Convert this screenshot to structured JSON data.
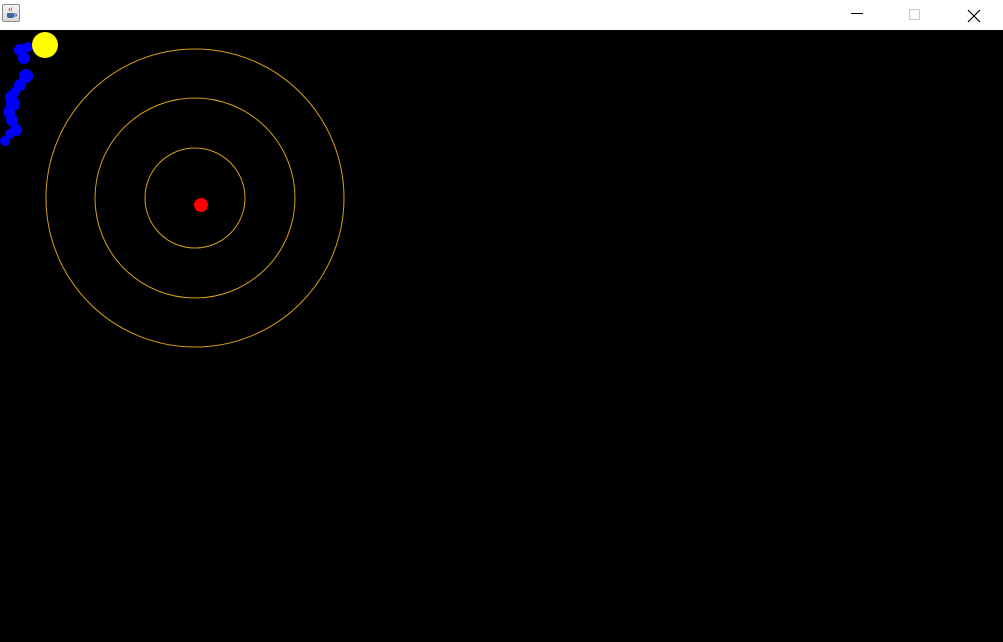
{
  "window": {
    "title": "",
    "icon": "java-coffee-cup-icon",
    "controls": {
      "minimize_icon": "minimize-icon",
      "maximize_icon": "maximize-icon",
      "close_icon": "close-icon"
    }
  },
  "scene": {
    "background_color": "#000000",
    "orbit_color": "#d4a017",
    "orbit_count": 3,
    "center_body": {
      "name": "red-dot",
      "color": "#ff0000"
    },
    "ball": {
      "name": "yellow-ball",
      "color": "#ffff00"
    },
    "trail": {
      "name": "blue-trail",
      "color": "#0000ff"
    }
  }
}
